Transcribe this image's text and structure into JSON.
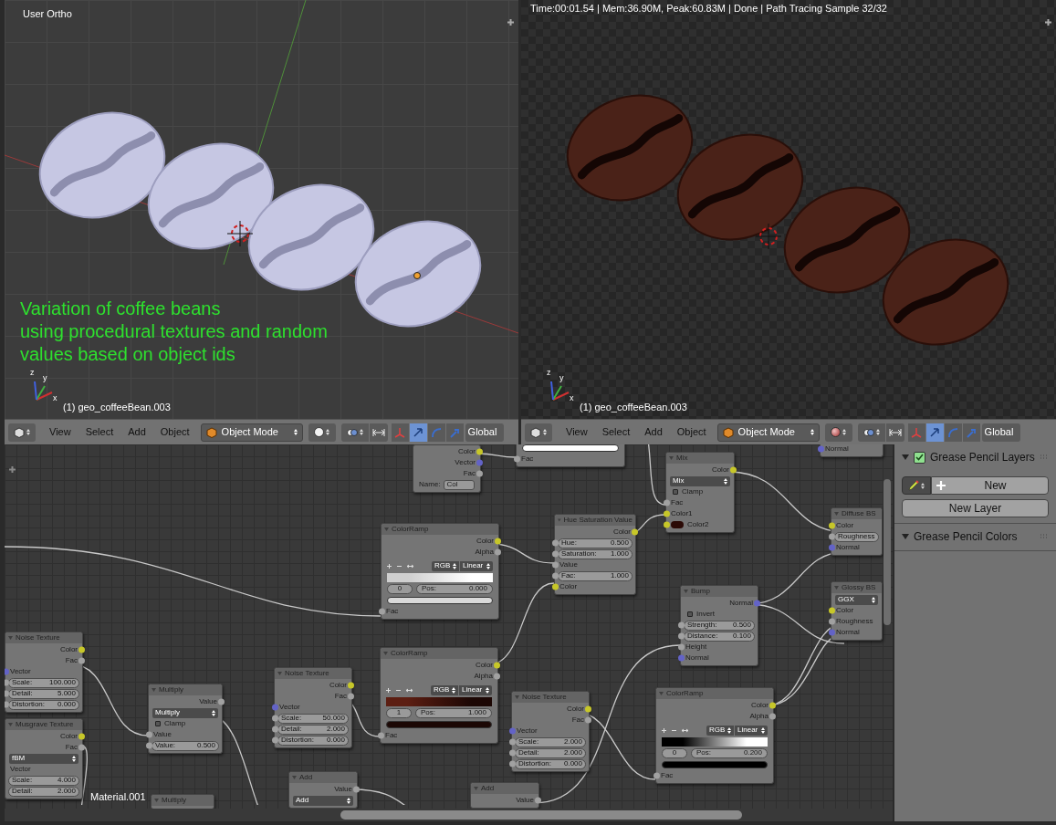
{
  "viewports": [
    {
      "kind": "solid",
      "title": "User Ortho",
      "overlay_lines": [
        "Variation of coffee beans",
        "using procedural textures and random",
        "values based on object ids"
      ],
      "axis_labels": [
        "z",
        "y",
        "x"
      ],
      "object_label": "(1) geo_coffeeBean.003"
    },
    {
      "kind": "rendered",
      "status": "Time:00:01.54 | Mem:36.90M, Peak:60.83M | Done | Path Tracing Sample 32/32",
      "axis_labels": [
        "z",
        "y",
        "x"
      ],
      "object_label": "(1) geo_coffeeBean.003"
    }
  ],
  "headers": [
    {
      "menus": [
        "View",
        "Select",
        "Add",
        "Object"
      ],
      "mode": "Object Mode",
      "manipulators": [
        {
          "kind": "axes",
          "selected": false
        },
        {
          "kind": "translate",
          "selected": true
        },
        {
          "kind": "rotate",
          "selected": false
        },
        {
          "kind": "scale",
          "selected": false
        }
      ],
      "orientation": "Global"
    },
    {
      "menus": [
        "View",
        "Select",
        "Add",
        "Object"
      ],
      "mode": "Object Mode",
      "manipulators": [
        {
          "kind": "axes",
          "selected": false
        },
        {
          "kind": "translate",
          "selected": true
        },
        {
          "kind": "rotate",
          "selected": false
        },
        {
          "kind": "scale",
          "selected": false
        }
      ],
      "orientation": "Global"
    }
  ],
  "node_editor": {
    "material": "Material.001",
    "nodes": [
      {
        "rows": [
          {
            "kind": "output",
            "label": "Color",
            "socket": {
              "color": "#c7c729"
            }
          },
          {
            "kind": "output",
            "label": "Vector",
            "socket": {
              "color": "#6363c7"
            }
          },
          {
            "kind": "output",
            "label": "Fac",
            "socket": {
              "color": "#a1a1a1"
            }
          },
          {
            "kind": "text_field",
            "label": "Name:",
            "value": "Col"
          }
        ]
      },
      {
        "rows": [
          {
            "kind": "swatch",
            "color": "#ffffff"
          },
          {
            "kind": "input",
            "label": "Fac",
            "socket": {
              "color": "#a1a1a1"
            }
          }
        ]
      },
      {
        "title": "Mix",
        "rows": [
          {
            "kind": "output",
            "label": "Color",
            "socket": {
              "color": "#c7c729"
            }
          },
          {
            "kind": "dropdown",
            "value": "Mix"
          },
          {
            "kind": "checkbox",
            "label": "Clamp",
            "checked": false
          },
          {
            "kind": "input",
            "label": "Fac",
            "socket": {
              "color": "#a1a1a1"
            }
          },
          {
            "kind": "input",
            "label": "Color1",
            "socket": {
              "color": "#c7c729"
            }
          },
          {
            "kind": "input",
            "label": "Color2",
            "socket": {
              "color": "#c7c729"
            },
            "swatch": {
              "color": "#2b0a06"
            }
          }
        ]
      },
      {
        "rows": [
          {
            "kind": "input",
            "label": "Normal",
            "socket": {
              "color": "#6363c7"
            }
          }
        ]
      },
      {
        "title": "Diffuse BS",
        "rows": [
          {
            "kind": "input",
            "label": "Color",
            "socket": {
              "color": "#c7c729"
            }
          },
          {
            "kind": "field",
            "label": "Roughness",
            "socket": {
              "color": "#a1a1a1"
            }
          },
          {
            "kind": "input",
            "label": "Normal",
            "socket": {
              "color": "#6363c7"
            }
          }
        ]
      },
      {
        "title": "Glossy BS",
        "rows": [
          {
            "kind": "dropdown",
            "value": "GGX"
          },
          {
            "kind": "input",
            "label": "Color",
            "socket": {
              "color": "#c7c729"
            }
          },
          {
            "kind": "input",
            "label": "Roughness",
            "socket": {
              "color": "#a1a1a1"
            }
          },
          {
            "kind": "input",
            "label": "Normal",
            "socket": {
              "color": "#6363c7"
            }
          }
        ]
      },
      {
        "title": "ColorRamp",
        "rows": [
          {
            "kind": "output",
            "label": "Color",
            "socket": {
              "color": "#c7c729"
            }
          },
          {
            "kind": "output",
            "label": "Alpha",
            "socket": {
              "color": "#a1a1a1"
            }
          },
          {
            "kind": "ramp",
            "mode": "RGB",
            "interpolation": "Linear",
            "stops": [
              {
                "color": "#cfcfcf"
              },
              {
                "color": "#ffffff"
              }
            ]
          },
          {
            "kind": "stop",
            "index": "0",
            "label": "Pos:",
            "value": "0.000"
          },
          {
            "kind": "swatch",
            "color": "#d9d9d9"
          },
          {
            "kind": "input",
            "label": "Fac",
            "socket": {
              "color": "#a1a1a1"
            }
          }
        ]
      },
      {
        "title": "Hue Saturation Value",
        "rows": [
          {
            "kind": "output",
            "label": "Color",
            "socket": {
              "color": "#c7c729"
            }
          },
          {
            "kind": "field",
            "label": "Hue:",
            "value": "0.500",
            "socket": {
              "color": "#a1a1a1"
            }
          },
          {
            "kind": "field",
            "label": "Saturation:",
            "value": "1.000",
            "socket": {
              "color": "#a1a1a1"
            }
          },
          {
            "kind": "input",
            "label": "Value",
            "socket": {
              "color": "#a1a1a1"
            }
          },
          {
            "kind": "field",
            "label": "Fac:",
            "value": "1.000",
            "socket": {
              "color": "#a1a1a1"
            }
          },
          {
            "kind": "input",
            "label": "Color",
            "socket": {
              "color": "#c7c729"
            }
          }
        ]
      },
      {
        "title": "Bump",
        "rows": [
          {
            "kind": "output",
            "label": "Normal",
            "socket": {
              "color": "#6363c7"
            }
          },
          {
            "kind": "checkbox",
            "label": "Invert",
            "checked": false
          },
          {
            "kind": "field",
            "label": "Strength:",
            "value": "0.500",
            "socket": {
              "color": "#a1a1a1"
            }
          },
          {
            "kind": "field",
            "label": "Distance:",
            "value": "0.100",
            "socket": {
              "color": "#a1a1a1"
            }
          },
          {
            "kind": "input",
            "label": "Height",
            "socket": {
              "color": "#a1a1a1"
            }
          },
          {
            "kind": "input",
            "label": "Normal",
            "socket": {
              "color": "#6363c7"
            }
          }
        ]
      },
      {
        "title": "Noise Texture",
        "rows": [
          {
            "kind": "output",
            "label": "Color",
            "socket": {
              "color": "#c7c729"
            }
          },
          {
            "kind": "output",
            "label": "Fac",
            "socket": {
              "color": "#a1a1a1"
            }
          },
          {
            "kind": "input",
            "label": "Vector",
            "socket": {
              "color": "#6363c7"
            }
          },
          {
            "kind": "field",
            "label": "Scale:",
            "value": "100.000",
            "socket": {
              "color": "#a1a1a1"
            }
          },
          {
            "kind": "field",
            "label": "Detail:",
            "value": "5.000",
            "socket": {
              "color": "#a1a1a1"
            }
          },
          {
            "kind": "field",
            "label": "Distortion:",
            "value": "0.000",
            "socket": {
              "color": "#a1a1a1"
            }
          }
        ]
      },
      {
        "title": "Musgrave Texture",
        "rows": [
          {
            "kind": "output",
            "label": "Color",
            "socket": {
              "color": "#c7c729"
            }
          },
          {
            "kind": "output",
            "label": "Fac",
            "socket": {
              "color": "#a1a1a1"
            }
          },
          {
            "kind": "dropdown",
            "value": "fBM"
          },
          {
            "kind": "input",
            "label": "Vector"
          },
          {
            "kind": "field",
            "label": "Scale:",
            "value": "4.000"
          },
          {
            "kind": "field",
            "label": "Detail:",
            "value": "2.000"
          }
        ]
      },
      {
        "title": "Multiply",
        "rows": [
          {
            "kind": "output",
            "label": "Value",
            "socket": {
              "color": "#a1a1a1"
            }
          },
          {
            "kind": "dropdown",
            "value": "Multiply"
          },
          {
            "kind": "checkbox",
            "label": "Clamp",
            "checked": false
          },
          {
            "kind": "input",
            "label": "Value",
            "socket": {
              "color": "#a1a1a1"
            }
          },
          {
            "kind": "field",
            "label": "Value:",
            "value": "0.500",
            "socket": {
              "color": "#a1a1a1"
            }
          }
        ]
      },
      {
        "title": "Noise Texture",
        "rows": [
          {
            "kind": "output",
            "label": "Color",
            "socket": {
              "color": "#c7c729"
            }
          },
          {
            "kind": "output",
            "label": "Fac",
            "socket": {
              "color": "#a1a1a1"
            }
          },
          {
            "kind": "input",
            "label": "Vector",
            "socket": {
              "color": "#6363c7"
            }
          },
          {
            "kind": "field",
            "label": "Scale:",
            "value": "50.000",
            "socket": {
              "color": "#a1a1a1"
            }
          },
          {
            "kind": "field",
            "label": "Detail:",
            "value": "2.000",
            "socket": {
              "color": "#a1a1a1"
            }
          },
          {
            "kind": "field",
            "label": "Distortion:",
            "value": "0.000",
            "socket": {
              "color": "#a1a1a1"
            }
          }
        ]
      },
      {
        "title": "ColorRamp",
        "rows": [
          {
            "kind": "output",
            "label": "Color",
            "socket": {
              "color": "#c7c729"
            }
          },
          {
            "kind": "output",
            "label": "Alpha",
            "socket": {
              "color": "#a1a1a1"
            }
          },
          {
            "kind": "ramp",
            "mode": "RGB",
            "interpolation": "Linear",
            "stops": [
              {
                "color": "#5c1e12"
              },
              {
                "color": "#1c0704"
              }
            ]
          },
          {
            "kind": "stop",
            "index": "1",
            "label": "Pos:",
            "value": "1.000"
          },
          {
            "kind": "swatch",
            "color": "#1c0805"
          },
          {
            "kind": "input",
            "label": "Fac",
            "socket": {
              "color": "#a1a1a1"
            }
          }
        ]
      },
      {
        "title": "Noise Texture",
        "rows": [
          {
            "kind": "output",
            "label": "Color",
            "socket": {
              "color": "#c7c729"
            }
          },
          {
            "kind": "output",
            "label": "Fac",
            "socket": {
              "color": "#a1a1a1"
            }
          },
          {
            "kind": "input",
            "label": "Vector",
            "socket": {
              "color": "#6363c7"
            }
          },
          {
            "kind": "field",
            "label": "Scale:",
            "value": "2.000",
            "socket": {
              "color": "#a1a1a1"
            }
          },
          {
            "kind": "field",
            "label": "Detail:",
            "value": "2.000",
            "socket": {
              "color": "#a1a1a1"
            }
          },
          {
            "kind": "field",
            "label": "Distortion:",
            "value": "0.000",
            "socket": {
              "color": "#a1a1a1"
            }
          }
        ]
      },
      {
        "title": "ColorRamp",
        "rows": [
          {
            "kind": "output",
            "label": "Color",
            "socket": {
              "color": "#c7c729"
            }
          },
          {
            "kind": "output",
            "label": "Alpha",
            "socket": {
              "color": "#a1a1a1"
            }
          },
          {
            "kind": "ramp",
            "mode": "RGB",
            "interpolation": "Linear",
            "stops": [
              {
                "color": "#000000"
              },
              {
                "color": "#ffffff"
              }
            ]
          },
          {
            "kind": "stop",
            "index": "0",
            "label": "Pos:",
            "value": "0.200"
          },
          {
            "kind": "swatch",
            "color": "#000000"
          },
          {
            "kind": "input",
            "label": "Fac",
            "socket": {
              "color": "#a1a1a1"
            }
          }
        ]
      },
      {
        "title": "Multiply"
      },
      {
        "title": "Add",
        "rows": [
          {
            "kind": "output",
            "label": "Value",
            "socket": {
              "color": "#a1a1a1"
            }
          },
          {
            "kind": "dropdown",
            "value": "Add"
          }
        ]
      },
      {
        "title": "Add",
        "rows": [
          {
            "kind": "output",
            "label": "Value",
            "socket": {
              "color": "#a1a1a1"
            }
          }
        ]
      }
    ]
  },
  "sidebar": {
    "panels": [
      {
        "kind": "layers",
        "title": "Grease Pencil Layers",
        "expanded": true,
        "checked": true,
        "new_button": "New",
        "layer_button": "New Layer"
      },
      {
        "kind": "colors",
        "title": "Grease Pencil Colors",
        "expanded": true
      }
    ]
  }
}
